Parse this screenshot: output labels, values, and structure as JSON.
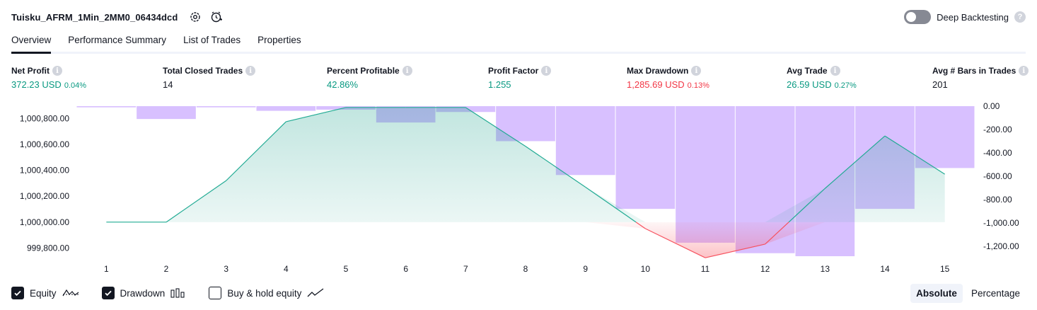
{
  "header": {
    "title": "Tuisku_AFRM_1Min_2MM0_06434dcd",
    "deep_backtesting_label": "Deep Backtesting",
    "help": "?"
  },
  "tabs": [
    {
      "label": "Overview",
      "active": true
    },
    {
      "label": "Performance Summary",
      "active": false
    },
    {
      "label": "List of Trades",
      "active": false
    },
    {
      "label": "Properties",
      "active": false
    }
  ],
  "metrics": [
    {
      "label": "Net Profit",
      "value": "372.23 USD",
      "pct": "0.04%",
      "color": "#089981"
    },
    {
      "label": "Total Closed Trades",
      "value": "14",
      "pct": "",
      "color": "#131722"
    },
    {
      "label": "Percent Profitable",
      "value": "42.86%",
      "pct": "",
      "color": "#089981"
    },
    {
      "label": "Profit Factor",
      "value": "1.255",
      "pct": "",
      "color": "#089981"
    },
    {
      "label": "Max Drawdown",
      "value": "1,285.69 USD",
      "pct": "0.13%",
      "color": "#f23645"
    },
    {
      "label": "Avg Trade",
      "value": "26.59 USD",
      "pct": "0.27%",
      "color": "#089981"
    },
    {
      "label": "Avg # Bars in Trades",
      "value": "201",
      "pct": "",
      "color": "#131722"
    }
  ],
  "info_glyph": "i",
  "chart_data": {
    "type": "area",
    "x": [
      1,
      2,
      3,
      4,
      5,
      6,
      7,
      8,
      9,
      10,
      11,
      12,
      13,
      14,
      15
    ],
    "x_tick_labels": [
      "1",
      "2",
      "3",
      "4",
      "5",
      "6",
      "7",
      "8",
      "9",
      "10",
      "11",
      "12",
      "13",
      "14",
      "15"
    ],
    "series": [
      {
        "kind": "equity_line",
        "axis": "left",
        "values": [
          1000000,
          1000000,
          1000320,
          1000775,
          1000885,
          1000885,
          1000885,
          1000585,
          1000270,
          999950,
          999725,
          999830,
          1000260,
          1000665,
          1000370
        ]
      },
      {
        "kind": "drawdown_bars",
        "axis": "right",
        "values": [
          -10,
          -110,
          -10,
          -40,
          -30,
          -140,
          -50,
          -300,
          -590,
          -880,
          -1170,
          -1260,
          -1285.69,
          -880,
          -530
        ]
      }
    ],
    "left_axis": {
      "ylim": [
        999715,
        1000895
      ],
      "ticks": [
        "1,000,800.00",
        "1,000,600.00",
        "1,000,400.00",
        "1,000,200.00",
        "1,000,000.00",
        "999,800.00"
      ],
      "tick_values": [
        1000800,
        1000600,
        1000400,
        1000200,
        1000000,
        999800
      ]
    },
    "right_axis": {
      "ylim": [
        -1310,
        0
      ],
      "ticks": [
        "0.00",
        "-200.00",
        "-400.00",
        "-600.00",
        "-800.00",
        "-1,000.00",
        "-1,200.00"
      ],
      "tick_values": [
        0,
        -200,
        -400,
        -600,
        -800,
        -1000,
        -1200
      ]
    },
    "colors": {
      "equity_up": "#22ab94",
      "equity_down": "#f7525f",
      "equity_fill": "#089981",
      "drawdown": "#d1b5ff"
    },
    "grid": false
  },
  "footer": {
    "equity_label": "Equity",
    "drawdown_label": "Drawdown",
    "buyhold_label": "Buy & hold equity",
    "absolute_label": "Absolute",
    "percentage_label": "Percentage"
  }
}
